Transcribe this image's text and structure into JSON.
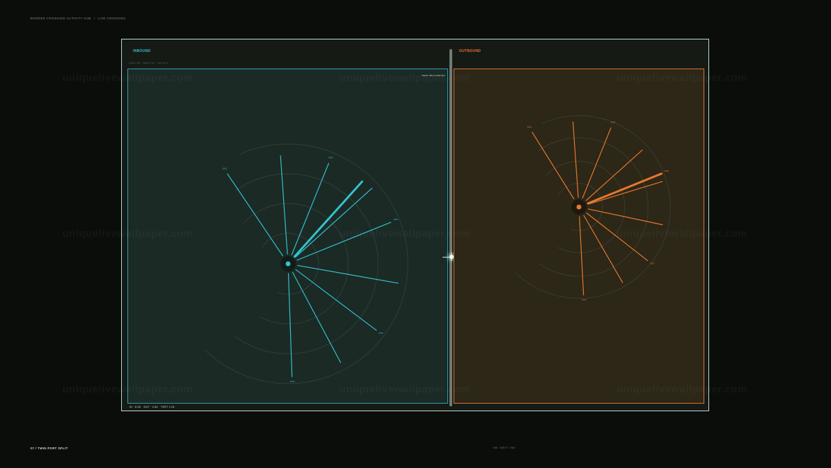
{
  "header": {
    "title": "BORDER CROSSING ACTIVITY HUB",
    "separator": "/",
    "subtitle": "LIVE CROSSING"
  },
  "inbound": {
    "title": "INBOUND",
    "subline": "LINE 2.5K · THRU 4.0K · HST 31.6",
    "corner_tag": "NEAR RECOVERING",
    "bottom_tag": [
      "IN · 8.4K",
      "OUT · 4.3K",
      "THRT 1.0K"
    ],
    "color": "#33c2cf",
    "rays": [
      {
        "angle": -124,
        "len": 0.92,
        "label": "0300"
      },
      {
        "angle": -94,
        "len": 0.92,
        "label": ""
      },
      {
        "angle": -68,
        "len": 0.92,
        "label": "0600"
      },
      {
        "angle": -48,
        "len": 0.94,
        "label": "",
        "highlight": true
      },
      {
        "angle": -42,
        "len": 0.96,
        "label": ""
      },
      {
        "angle": -22,
        "len": 0.94,
        "label": "0900"
      },
      {
        "angle": 10,
        "len": 0.95,
        "label": ""
      },
      {
        "angle": 37,
        "len": 0.94,
        "label": "1200"
      },
      {
        "angle": 62,
        "len": 0.95,
        "label": ""
      },
      {
        "angle": 88,
        "len": 0.96,
        "label": "1500"
      }
    ]
  },
  "outbound": {
    "title": "OUTBOUND",
    "color": "#e8772e",
    "rays": [
      {
        "angle": -122,
        "len": 0.95,
        "label": "0300"
      },
      {
        "angle": -94,
        "len": 0.92,
        "label": ""
      },
      {
        "angle": -68,
        "len": 0.92,
        "label": "0600"
      },
      {
        "angle": -42,
        "len": 0.92,
        "label": ""
      },
      {
        "angle": -22,
        "len": 0.96,
        "label": "0900",
        "highlight": true
      },
      {
        "angle": -17,
        "len": 0.94,
        "label": ""
      },
      {
        "angle": 12,
        "len": 0.92,
        "label": ""
      },
      {
        "angle": 38,
        "len": 0.94,
        "label": "1200"
      },
      {
        "angle": 60,
        "len": 0.94,
        "label": ""
      },
      {
        "angle": 87,
        "len": 0.95,
        "label": "1500"
      }
    ]
  },
  "watermark": "uniquelivewallpaper.com",
  "footer": {
    "left": "07 / TWIN PORT SPLIT",
    "mid": "NW / WEST / NW"
  }
}
